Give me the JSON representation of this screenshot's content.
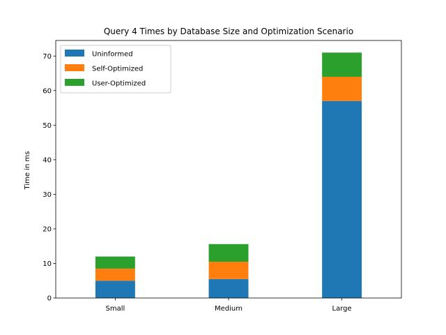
{
  "chart_data": {
    "type": "bar",
    "stacked": true,
    "title": "Query 4 Times by Database Size and Optimization Scenario",
    "xlabel": "",
    "ylabel": "Time in ms",
    "categories": [
      "Small",
      "Medium",
      "Large"
    ],
    "series": [
      {
        "name": "Uninformed",
        "values": [
          5.0,
          5.5,
          57.0
        ],
        "color": "#1f77b4"
      },
      {
        "name": "Self-Optimized",
        "values": [
          3.5,
          5.0,
          7.0
        ],
        "color": "#ff7f0e"
      },
      {
        "name": "User-Optimized",
        "values": [
          3.5,
          5.1,
          7.0
        ],
        "color": "#2ca02c"
      }
    ],
    "ylim": [
      0,
      74.5
    ],
    "yticks": [
      0,
      10,
      20,
      30,
      40,
      50,
      60,
      70
    ],
    "legend_position": "top-left",
    "grid": false
  }
}
